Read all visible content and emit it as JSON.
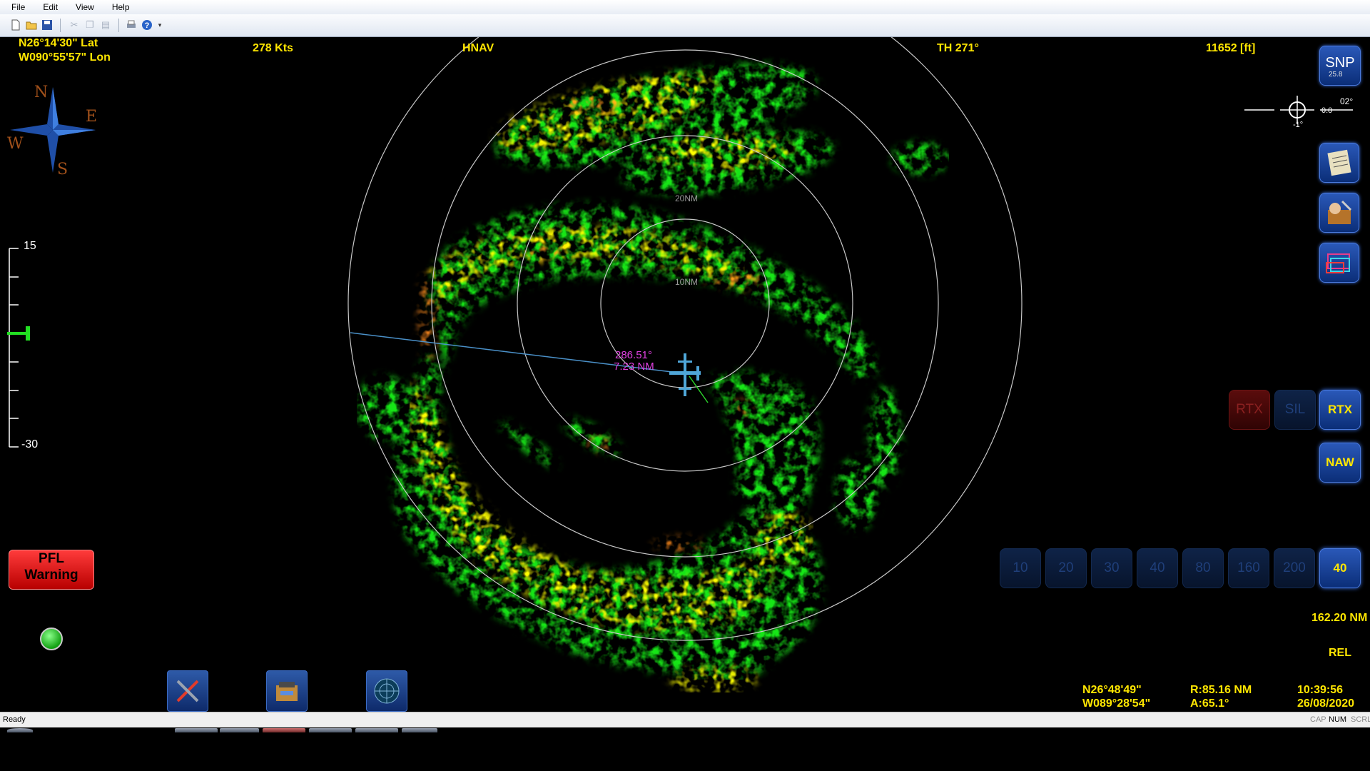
{
  "menu": [
    "File",
    "Edit",
    "View",
    "Help"
  ],
  "header": {
    "lat": "N26°14'30\"  Lat",
    "lon": "W090°55'57\"  Lon",
    "speed": "278 Kts",
    "nav_mode": "HNAV",
    "heading": "TH 271°",
    "altitude": "11652 [ft]"
  },
  "compass": {
    "n": "N",
    "e": "E",
    "s": "S",
    "w": "W"
  },
  "tilt_scale": {
    "top": "15",
    "bottom": "-30"
  },
  "pfl_warning": {
    "line1": "PFL",
    "line2": "Warning"
  },
  "radar": {
    "ring_labels": [
      "10NM",
      "20NM"
    ],
    "cursor_bearing": "286.51°",
    "cursor_range": "7.23 NM"
  },
  "right_panel": {
    "snp_label": "SNP",
    "snp_sub": "25.8",
    "attitude_right": "02°",
    "attitude_value": "0.0",
    "attitude_bottom": "-1°",
    "modes": [
      "RTX",
      "SIL",
      "RTX"
    ],
    "naw_label": "NAW",
    "ranges": [
      "10",
      "20",
      "30",
      "40",
      "80",
      "160",
      "200",
      "40"
    ],
    "range_readout": "162.20 NM",
    "rel_label": "REL"
  },
  "footer": {
    "cursor_lat": "N26°48'49\"",
    "cursor_lon": "W089°28'54\"",
    "cursor_r": "R:85.16 NM",
    "cursor_a": "A:65.1°",
    "time": "10:39:56",
    "date": "26/08/2020"
  },
  "statusbar": {
    "text": "Ready",
    "indicators": [
      "CAP",
      "NUM",
      "SCRL"
    ]
  }
}
